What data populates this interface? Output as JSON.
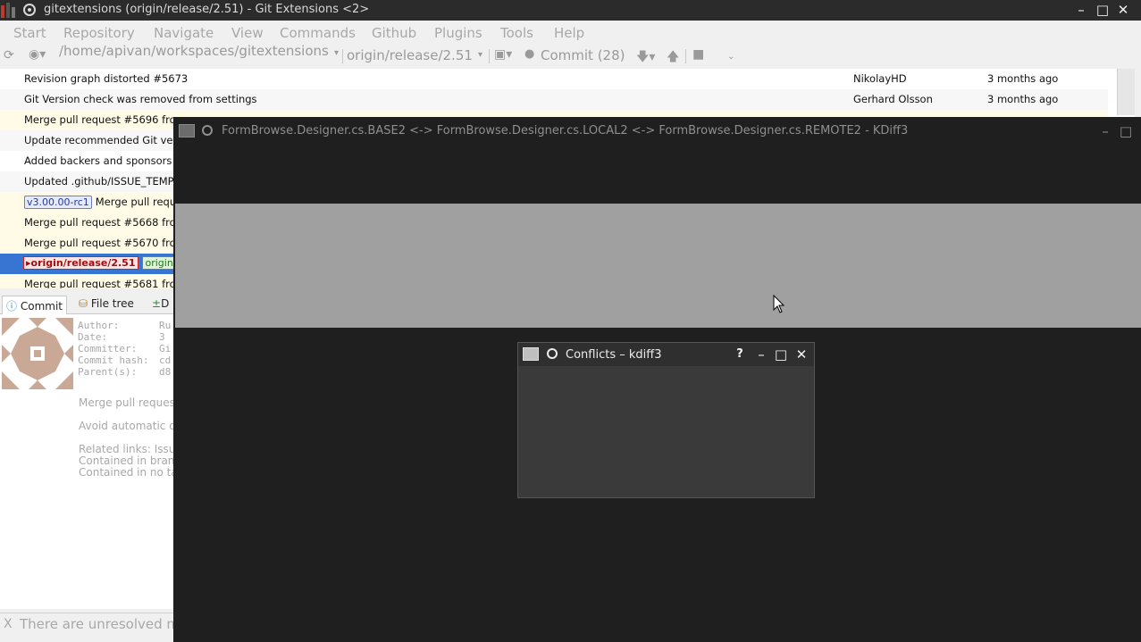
{
  "ge": {
    "title": "gitextensions (origin/release/2.51) - Git Extensions <2>",
    "window_controls": {
      "minimize": "–",
      "maximize": "□",
      "close": "✕"
    },
    "menu": [
      "Start",
      "Repository",
      "Navigate",
      "View",
      "Commands",
      "Github",
      "Plugins",
      "Tools",
      "Help"
    ],
    "toolbar": {
      "path": "/home/apivan/workspaces/gitextensions",
      "branch": "origin/release/2.51",
      "commit_label": "Commit (28)"
    },
    "revisions": [
      {
        "message": "Revision graph distorted #5673",
        "author": "NikolayHD",
        "date": "3 months ago"
      },
      {
        "message": "Git Version check was removed from settings",
        "author": "Gerhard Olsson",
        "date": "3 months ago"
      },
      {
        "message": "Merge pull request #5696 from ...",
        "author": "",
        "date": ""
      },
      {
        "message": "Update recommended Git version",
        "author": "",
        "date": ""
      },
      {
        "message": "Added backers and sponsors",
        "author": "",
        "date": ""
      },
      {
        "message": "Updated .github/ISSUE_TEMPLATE",
        "author": "",
        "date": ""
      },
      {
        "tag": "v3.00.00-rc1",
        "message": "Merge pull request",
        "author": "",
        "date": ""
      },
      {
        "message": "Merge pull request #5668 from",
        "author": "",
        "date": ""
      },
      {
        "message": "Merge pull request #5670 from",
        "author": "",
        "date": ""
      },
      {
        "branch": "origin/release/2.51",
        "remote": "origin",
        "message": "",
        "author": "",
        "date": ""
      },
      {
        "message": "Merge pull request #5681 from",
        "author": "",
        "date": ""
      }
    ],
    "detail_tabs": [
      "Commit",
      "File tree",
      "D"
    ],
    "commit_info": {
      "author_key": "Author:",
      "author_val": "Ru",
      "date_key": "Date:",
      "date_val": "3",
      "committer_key": "Committer:",
      "committer_val": "Gi",
      "hash_key": "Commit hash:",
      "hash_val": "cd",
      "parents_key": "Parent(s):",
      "parents_val": "d8",
      "body": [
        "Merge pull request",
        "Avoid automatic q",
        "Related links: Issue",
        "Contained in branc",
        "Contained in no ta"
      ]
    },
    "status": {
      "close": "X",
      "text": "There are unresolved m"
    }
  },
  "kdiff3": {
    "title": "FormBrowse.Designer.cs.BASE2 <-> FormBrowse.Designer.cs.LOCAL2 <-> FormBrowse.Designer.cs.REMOTE2 - KDiff3",
    "window_controls": {
      "minimize": "–",
      "maximize": "□"
    }
  },
  "conflicts": {
    "title": "Conflicts – kdiff3",
    "window_controls": {
      "help": "?",
      "minimize": "–",
      "maximize": "□",
      "close": "✕"
    }
  },
  "colors": {
    "selected_row": "#3874d1",
    "merge_row": "#fffbe6",
    "branch_tag": "#9c0e0e",
    "dark_bg": "#1f1f1f"
  }
}
